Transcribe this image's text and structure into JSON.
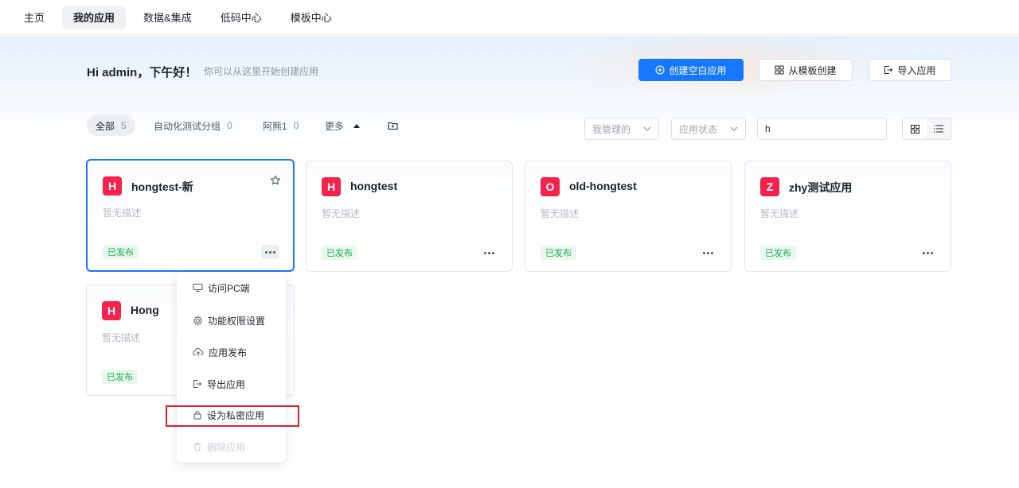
{
  "nav": [
    {
      "label": "主页",
      "active": false
    },
    {
      "label": "我的应用",
      "active": true
    },
    {
      "label": "数据&集成",
      "active": false
    },
    {
      "label": "低码中心",
      "active": false
    },
    {
      "label": "模板中心",
      "active": false
    }
  ],
  "header": {
    "greeting": "Hi admin，下午好！",
    "subtitle": "你可以从这里开始创建应用",
    "create_blank": "创建空白应用",
    "from_template": "从模板创建",
    "import_app": "导入应用"
  },
  "filters": {
    "groups": [
      {
        "label": "全部",
        "count": "5"
      },
      {
        "label": "自动化测试分组",
        "count": "0"
      },
      {
        "label": "阿熊1",
        "count": "0"
      }
    ],
    "more": "更多",
    "managed_by_placeholder": "我管理的",
    "status_placeholder": "应用状态",
    "search_value": "h"
  },
  "apps": [
    {
      "initial": "H",
      "name": "hongtest-新",
      "desc": "暂无描述",
      "status": "已发布"
    },
    {
      "initial": "H",
      "name": "hongtest",
      "desc": "暂无描述",
      "status": "已发布"
    },
    {
      "initial": "O",
      "name": "old-hongtest",
      "desc": "暂无描述",
      "status": "已发布"
    },
    {
      "initial": "Z",
      "name": "zhy测试应用",
      "desc": "暂无描述",
      "status": "已发布"
    },
    {
      "initial": "H",
      "name": "Hong",
      "desc": "暂无描述",
      "status": "已发布"
    }
  ],
  "menu": {
    "visit_pc": "访问PC端",
    "permissions": "功能权限设置",
    "publish": "应用发布",
    "export": "导出应用",
    "set_private": "设为私密应用",
    "delete": "删除应用"
  },
  "colors": {
    "primary": "#1677ff",
    "app_icon": "#f5224b",
    "published": "#1fae4f",
    "highlight": "#e0202e"
  }
}
